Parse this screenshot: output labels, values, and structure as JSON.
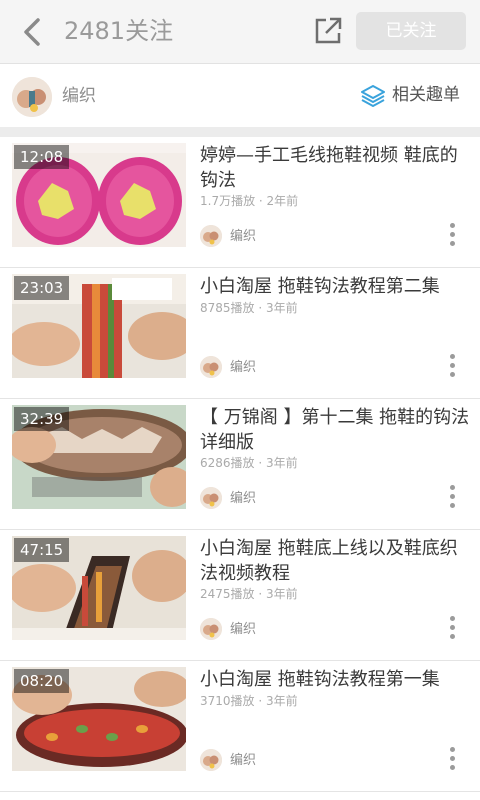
{
  "header": {
    "title": "2481关注",
    "follow_label": "已关注"
  },
  "tag": {
    "name": "编织",
    "related_label": "相关趣单"
  },
  "colors": {
    "accent": "#3aa3dc",
    "follow_button_bg": "#e3e3e3"
  },
  "videos": [
    {
      "duration": "12:08",
      "title": "婷婷—手工毛线拖鞋视频 鞋底的钩法",
      "meta": "1.7万播放 · 2年前",
      "author": "编织"
    },
    {
      "duration": "23:03",
      "title": "小白淘屋 拖鞋钩法教程第二集",
      "meta": "8785播放 · 3年前",
      "author": "编织"
    },
    {
      "duration": "32:39",
      "title": "【 万锦阁 】第十二集  拖鞋的钩法  详细版",
      "meta": "6286播放 · 3年前",
      "author": "编织"
    },
    {
      "duration": "47:15",
      "title": "小白淘屋 拖鞋底上线以及鞋底织法视频教程",
      "meta": "2475播放 · 3年前",
      "author": "编织"
    },
    {
      "duration": "08:20",
      "title": "小白淘屋 拖鞋钩法教程第一集",
      "meta": "3710播放 · 3年前",
      "author": "编织"
    }
  ]
}
